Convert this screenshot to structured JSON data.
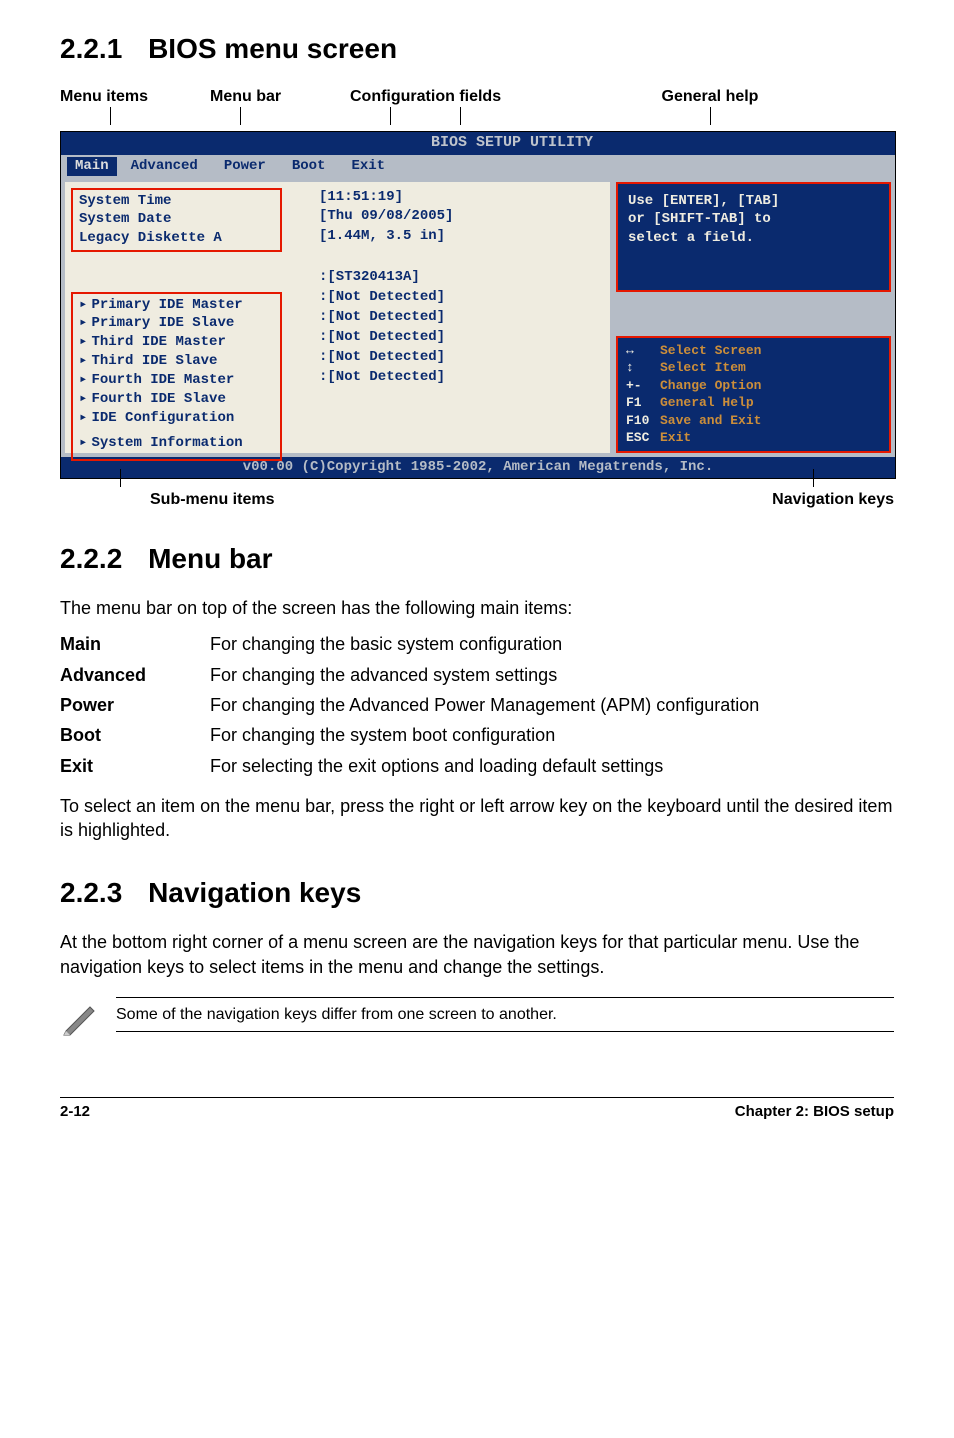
{
  "section_221": {
    "num": "2.2.1",
    "title": "BIOS menu screen"
  },
  "annot": {
    "menu_items": "Menu items",
    "menu_bar": "Menu bar",
    "config_fields": "Configuration fields",
    "general_help": "General help",
    "submenu": "Sub-menu items",
    "navkeys": "Navigation keys"
  },
  "bios": {
    "title": "BIOS SETUP UTILITY",
    "tabs": [
      "Main",
      "Advanced",
      "Power",
      "Boot",
      "Exit"
    ],
    "top_box": [
      "System Time",
      "System Date",
      "Legacy Diskette A"
    ],
    "bottom_box": [
      "Primary IDE Master",
      "Primary IDE Slave",
      "Third IDE Master",
      "Third IDE Slave",
      "Fourth IDE Master",
      "Fourth IDE Slave",
      "IDE Configuration",
      "System Information"
    ],
    "center_top": [
      "[11:51:19]",
      "[Thu 09/08/2005]",
      "[1.44M, 3.5 in]"
    ],
    "center_bot": [
      ":[ST320413A]",
      ":[Not Detected]",
      ":[Not Detected]",
      ":[Not Detected]",
      ":[Not Detected]",
      ":[Not Detected]"
    ],
    "help": [
      "Use [ENTER], [TAB]",
      "or [SHIFT-TAB] to",
      "select a field."
    ],
    "nav": [
      {
        "k": "↔",
        "v": "Select Screen"
      },
      {
        "k": "↕",
        "v": "Select Item"
      },
      {
        "k": "+-",
        "v": "Change Option"
      },
      {
        "k": "F1",
        "v": "General Help"
      },
      {
        "k": "F10",
        "v": "Save and Exit"
      },
      {
        "k": "ESC",
        "v": "Exit"
      }
    ],
    "footer": "v00.00 (C)Copyright 1985-2002, American Megatrends, Inc."
  },
  "section_222": {
    "num": "2.2.2",
    "title": "Menu bar",
    "intro": "The menu bar on top of the screen has the following main items:",
    "rows": [
      {
        "k": "Main",
        "v": "For changing the basic system configuration"
      },
      {
        "k": "Advanced",
        "v": "For changing the advanced system settings"
      },
      {
        "k": "Power",
        "v": "For changing the Advanced Power Management (APM) configuration"
      },
      {
        "k": "Boot",
        "v": "For changing the system boot configuration"
      },
      {
        "k": "Exit",
        "v": "For selecting the exit options and loading default settings"
      }
    ],
    "outro": "To select an item on the menu bar, press the right or left arrow key on the keyboard until the desired item is highlighted."
  },
  "section_223": {
    "num": "2.2.3",
    "title": "Navigation keys",
    "body": "At the bottom right corner of a menu screen are the navigation keys for that particular menu. Use the navigation keys to select items in the menu and change the settings.",
    "note": "Some of the navigation keys differ from one screen to another."
  },
  "page_footer": {
    "left": "2-12",
    "right": "Chapter 2: BIOS setup"
  }
}
